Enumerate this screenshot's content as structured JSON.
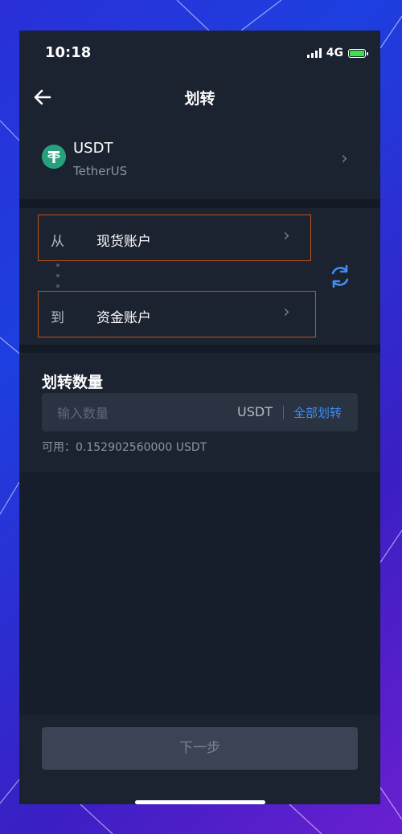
{
  "status_bar": {
    "time": "10:18",
    "network": "4G"
  },
  "nav": {
    "title": "划转"
  },
  "asset": {
    "symbol": "USDT",
    "name": "TetherUS",
    "icon": "tether-icon"
  },
  "transfer": {
    "from_label": "从",
    "from_account": "现货账户",
    "to_label": "到",
    "to_account": "资金账户"
  },
  "quantity": {
    "title": "划转数量",
    "placeholder": "输入数量",
    "unit": "USDT",
    "all_label": "全部划转",
    "available": "可用：0.152902560000 USDT"
  },
  "next_button": "下一步",
  "colors": {
    "background": "#1b2230",
    "accent_blue": "#3f8cf2",
    "highlight_border": "#c0541c",
    "tether_green": "#26a17b"
  }
}
